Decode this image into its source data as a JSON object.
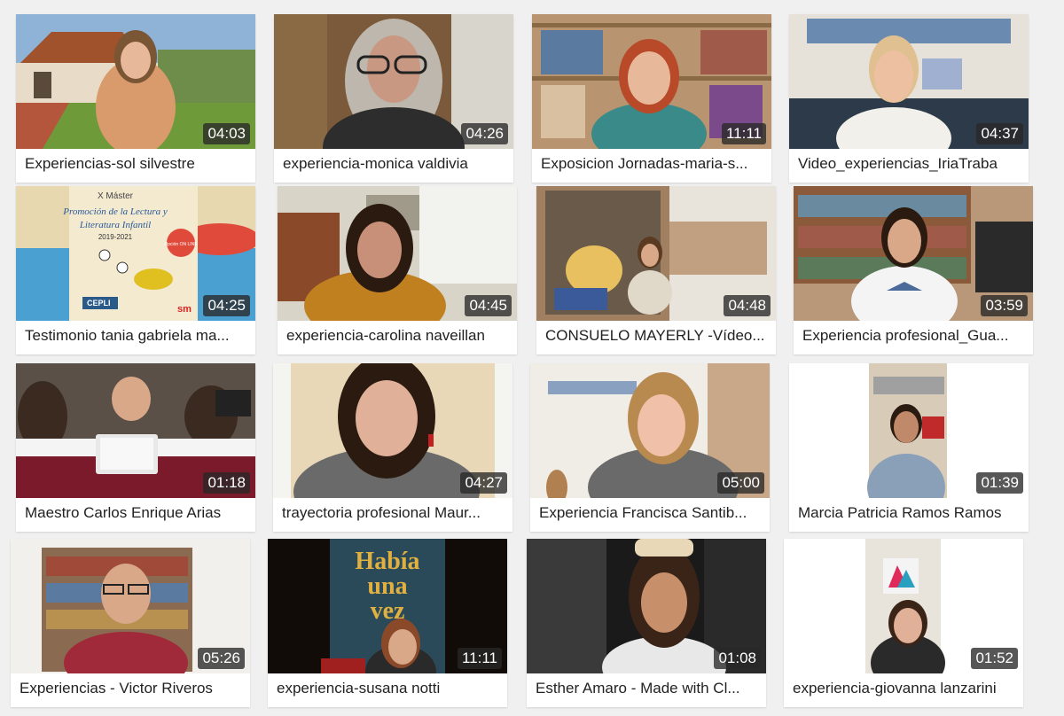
{
  "videos": [
    {
      "title": "Experiencias-sol silvestre",
      "duration": "04:03"
    },
    {
      "title": "experiencia-monica valdivia",
      "duration": "04:26"
    },
    {
      "title": "Exposicion Jornadas-maria-s...",
      "duration": "11:11"
    },
    {
      "title": "Video_experiencias_IriaTraba",
      "duration": "04:37"
    },
    {
      "title": "Testimonio tania gabriela ma...",
      "duration": "04:25",
      "thumb_text": {
        "line1": "X Máster",
        "line2": "Promoción de la Lectura y",
        "line3": "Literatura Infantil",
        "line4": "2019-2021",
        "badge": "Opción ON LINE",
        "brand1": "CEPLI",
        "brand2": "sm"
      }
    },
    {
      "title": "experiencia-carolina naveillan",
      "duration": "04:45"
    },
    {
      "title": "CONSUELO MAYERLY -Vídeo...",
      "duration": "04:48"
    },
    {
      "title": "Experiencia profesional_Gua...",
      "duration": "03:59"
    },
    {
      "title": "Maestro Carlos Enrique Arias",
      "duration": "01:18"
    },
    {
      "title": "trayectoria profesional Maur...",
      "duration": "04:27"
    },
    {
      "title": "Experiencia Francisca Santib...",
      "duration": "05:00"
    },
    {
      "title": "Marcia Patricia Ramos Ramos",
      "duration": "01:39"
    },
    {
      "title": "Experiencias - Victor Riveros",
      "duration": "05:26"
    },
    {
      "title": "experiencia-susana notti",
      "duration": "11:11",
      "thumb_text": {
        "line1": "Había",
        "line2": "una",
        "line3": "vez"
      }
    },
    {
      "title": "Esther Amaro - Made with Cl...",
      "duration": "01:08"
    },
    {
      "title": "experiencia-giovanna lanzarini",
      "duration": "01:52"
    }
  ]
}
